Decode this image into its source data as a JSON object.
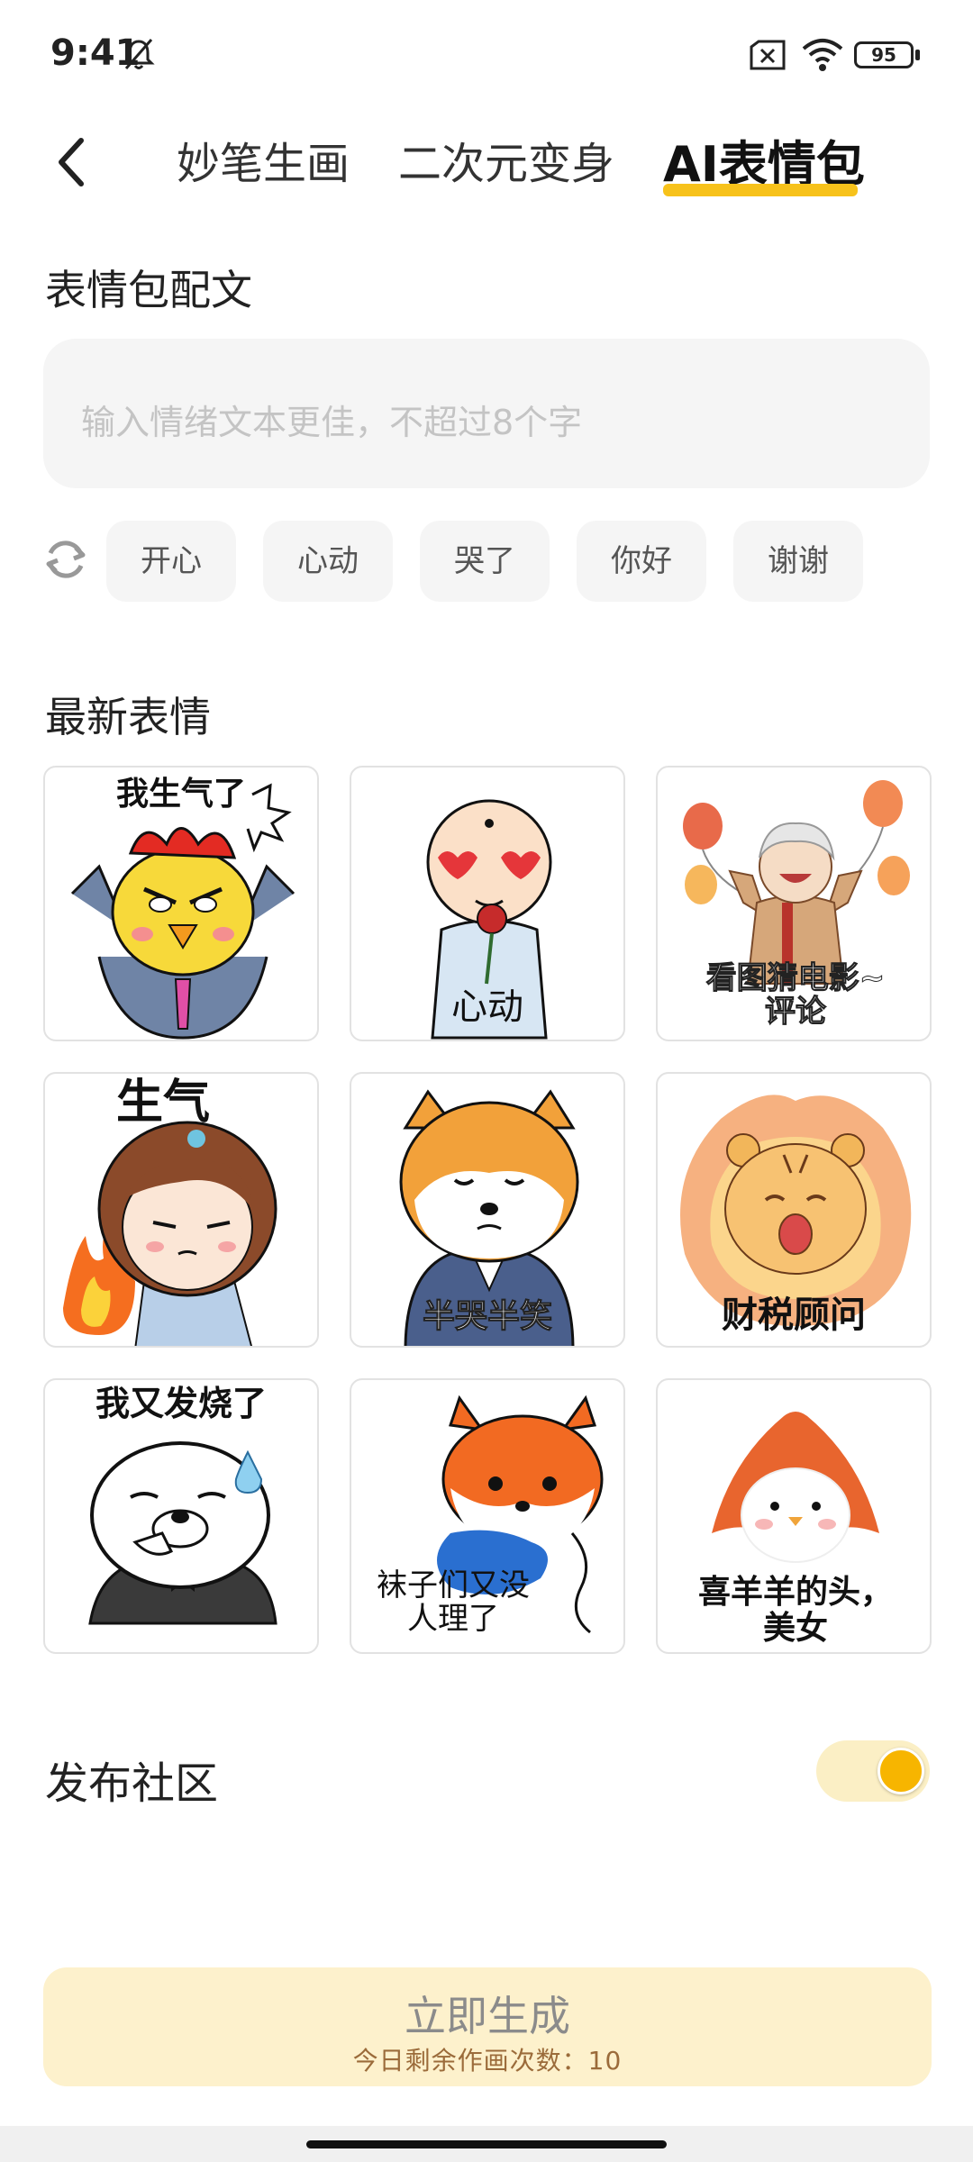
{
  "status_bar": {
    "time": "9:41",
    "battery": "95"
  },
  "nav": {
    "tabs": [
      {
        "label": "妙笔生画"
      },
      {
        "label": "二次元变身"
      },
      {
        "label": "AI表情包"
      }
    ],
    "active_tab_color": "#f7c21b"
  },
  "caption_section": {
    "title": "表情包配文",
    "placeholder": "输入情绪文本更佳，不超过8个字",
    "chips": [
      "开心",
      "心动",
      "哭了",
      "你好",
      "谢谢"
    ]
  },
  "latest_section": {
    "title": "最新表情",
    "items": [
      {
        "caption": "我生气了"
      },
      {
        "caption": "心动"
      },
      {
        "caption": "看图猜电影~评论"
      },
      {
        "caption": "生气"
      },
      {
        "caption": "半哭半笑"
      },
      {
        "caption": "财税顾问"
      },
      {
        "caption": "我又发烧了"
      },
      {
        "caption": "袜子们又没人理了"
      },
      {
        "caption": "喜羊羊的头，美女"
      }
    ]
  },
  "publish": {
    "label": "发布社区",
    "enabled": true
  },
  "generate": {
    "label": "立即生成",
    "remaining": "今日剩余作画次数：10"
  },
  "colors": {
    "accent": "#f7b500",
    "button_bg": "#fdf1cc"
  }
}
